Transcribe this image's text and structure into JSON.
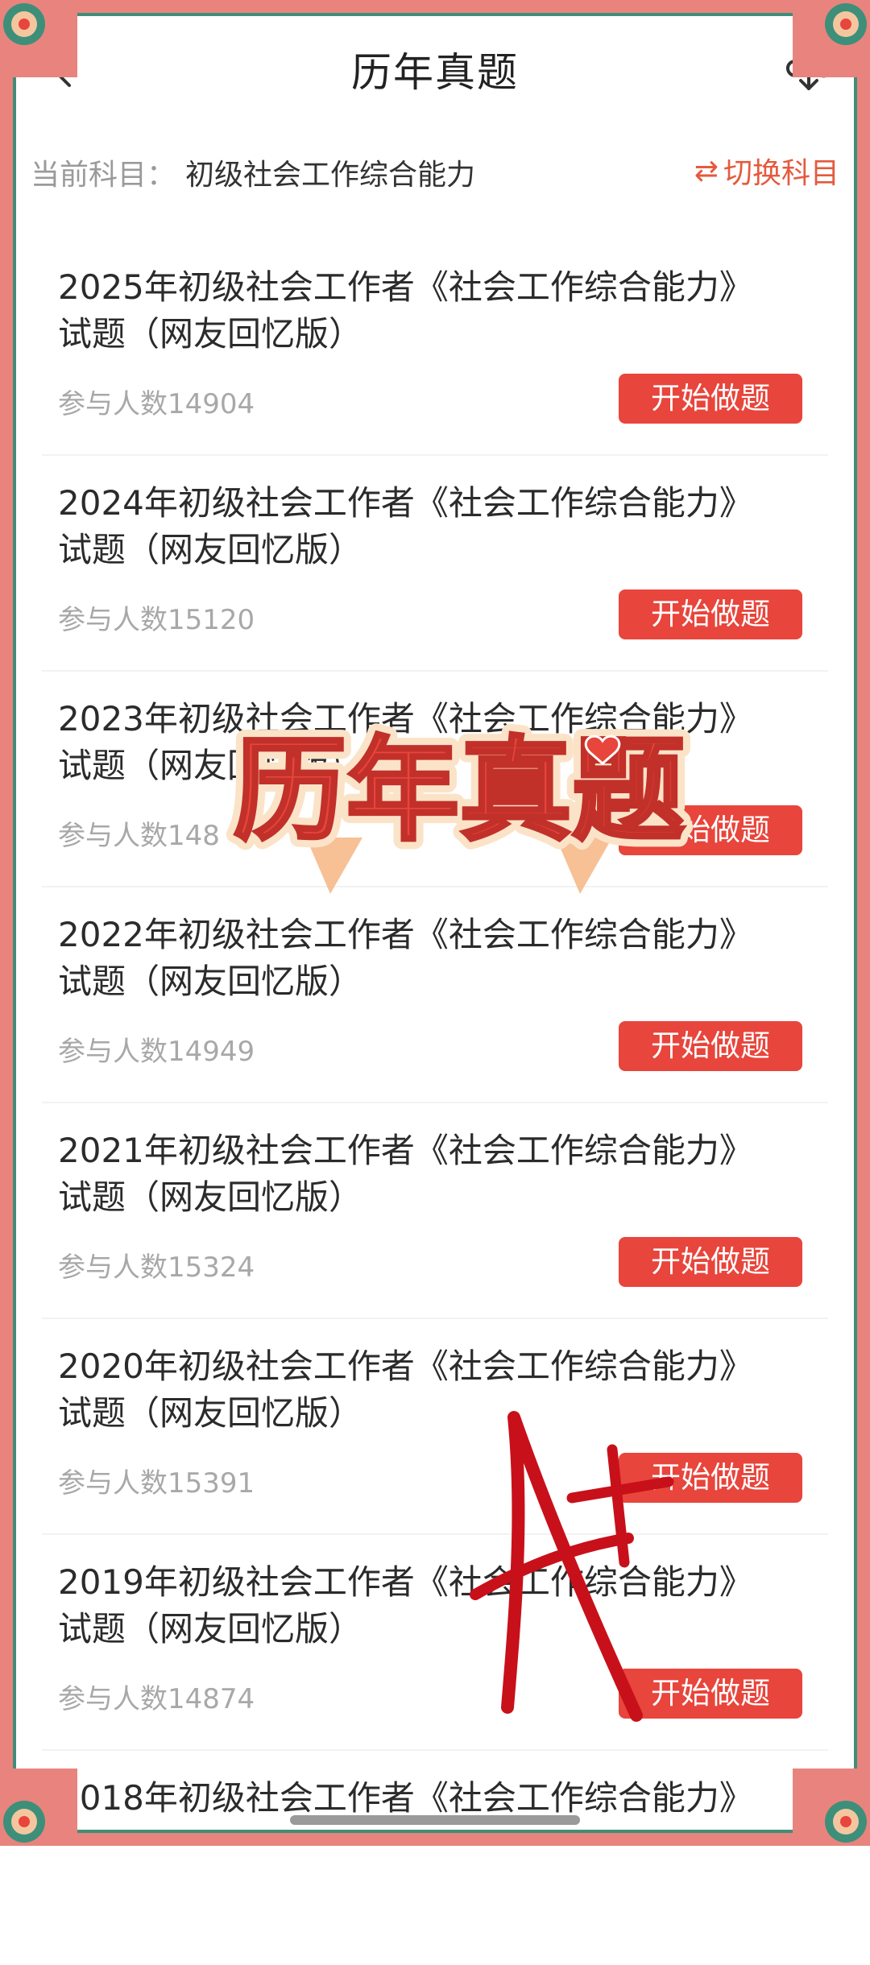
{
  "header": {
    "title": "历年真题",
    "back_icon": "chevron-left-icon",
    "download_icon": "cloud-download-icon"
  },
  "subject": {
    "prefix": "当前科目：",
    "name": "初级社会工作综合能力",
    "switch_icon": "⇄",
    "switch_label": "切换科目"
  },
  "items": [
    {
      "title": "2025年初级社会工作者《社会工作综合能力》试题（网友回忆版）",
      "count": "参与人数14904",
      "button": "开始做题"
    },
    {
      "title": "2024年初级社会工作者《社会工作综合能力》试题（网友回忆版）",
      "count": "参与人数15120",
      "button": "开始做题"
    },
    {
      "title": "2023年初级社会工作者《社会工作综合能力》试题（网友回忆版）",
      "count": "参与人数148",
      "button": "开始做题"
    },
    {
      "title": "2022年初级社会工作者《社会工作综合能力》试题（网友回忆版）",
      "count": "参与人数14949",
      "button": "开始做题"
    },
    {
      "title": "2021年初级社会工作者《社会工作综合能力》试题（网友回忆版）",
      "count": "参与人数15324",
      "button": "开始做题"
    },
    {
      "title": "2020年初级社会工作者《社会工作综合能力》试题（网友回忆版）",
      "count": "参与人数15391",
      "button": "开始做题"
    },
    {
      "title": "2019年初级社会工作者《社会工作综合能力》试题（网友回忆版）",
      "count": "参与人数14874",
      "button": "开始做题"
    },
    {
      "title": "2018年初级社会工作者《社会工作综合能力》",
      "count": "",
      "button": ""
    }
  ],
  "overlay": {
    "stamp_text": "历年真题",
    "stamp_color": "#e8453c",
    "handwriting": "A+"
  },
  "colors": {
    "accent": "#e8453c",
    "frame_pink": "#e8847d",
    "frame_green": "#3d8f7a"
  }
}
